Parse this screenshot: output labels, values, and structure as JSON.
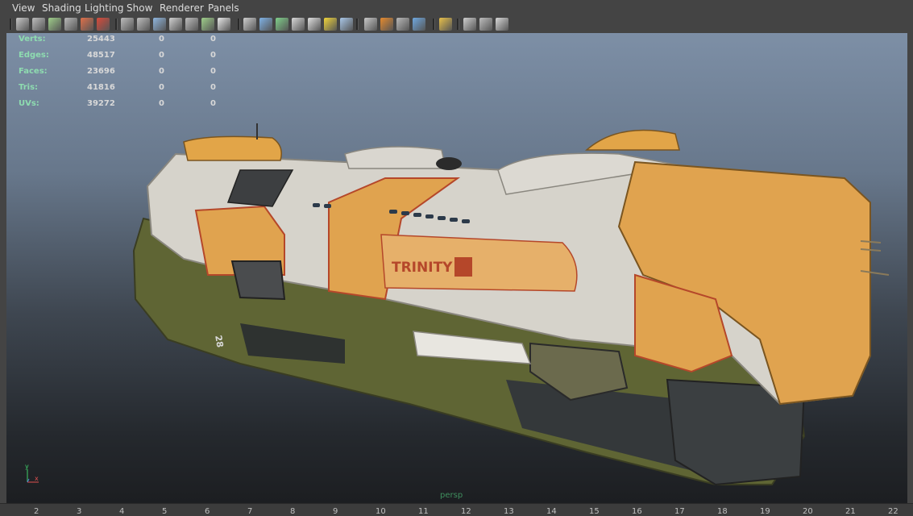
{
  "menu": [
    "View",
    "Shading",
    "Lighting",
    "Show",
    "Renderer",
    "Panels"
  ],
  "toolbar_icons": [
    {
      "name": "camera-icon",
      "color": "#c8c8c8"
    },
    {
      "name": "camera-attributes-icon",
      "color": "#bdbdbd"
    },
    {
      "name": "bookmark-icon",
      "color": "#9fcf8a"
    },
    {
      "name": "image-plane-icon",
      "color": "#b8b8b8"
    },
    {
      "name": "pan-zoom-icon",
      "color": "#e0704a"
    },
    {
      "name": "grease-pencil-icon",
      "color": "#d94a3a"
    },
    {
      "name": "grid-icon",
      "color": "#bdbdbd"
    },
    {
      "name": "film-gate-icon",
      "color": "#bdbdbd"
    },
    {
      "name": "resolution-gate-icon",
      "color": "#8fb6e0"
    },
    {
      "name": "gate-mask-icon",
      "color": "#d0d0d0"
    },
    {
      "name": "field-chart-icon",
      "color": "#bdbdbd"
    },
    {
      "name": "safe-action-icon",
      "color": "#9fcf8a"
    },
    {
      "name": "safe-title-icon",
      "color": "#e8e8e8"
    },
    {
      "name": "wireframe-icon",
      "color": "#cfcfcf"
    },
    {
      "name": "smooth-shade-icon",
      "color": "#7fb2e6"
    },
    {
      "name": "wireframe-on-shaded-icon",
      "color": "#7fd08a"
    },
    {
      "name": "default-material-icon",
      "color": "#d8d8d8"
    },
    {
      "name": "textured-icon",
      "color": "#e0e0e0"
    },
    {
      "name": "use-all-lights-icon",
      "color": "#f0d53a"
    },
    {
      "name": "shadows-icon",
      "color": "#a9c7e8"
    },
    {
      "name": "screen-space-ao-icon",
      "color": "#c8c8c8"
    },
    {
      "name": "motion-blur-icon",
      "color": "#e68a2e"
    },
    {
      "name": "anti-aliasing-icon",
      "color": "#b8b8b8"
    },
    {
      "name": "depth-of-field-icon",
      "color": "#6fa8e0"
    },
    {
      "name": "isolate-select-icon",
      "color": "#e8c04a"
    },
    {
      "name": "xray-icon",
      "color": "#cfcfcf"
    },
    {
      "name": "xray-joints-icon",
      "color": "#bdbdbd"
    },
    {
      "name": "xray-components-icon",
      "color": "#d8d8d8"
    }
  ],
  "hud": {
    "rows": [
      {
        "label": "Verts:",
        "v1": "25443",
        "v2": "0",
        "v3": "0"
      },
      {
        "label": "Edges:",
        "v1": "48517",
        "v2": "0",
        "v3": "0"
      },
      {
        "label": "Faces:",
        "v1": "23696",
        "v2": "0",
        "v3": "0"
      },
      {
        "label": "Tris:",
        "v1": "41816",
        "v2": "0",
        "v3": "0"
      },
      {
        "label": "UVs:",
        "v1": "39272",
        "v2": "0",
        "v3": "0"
      }
    ]
  },
  "ship": {
    "decal": "TRINITY",
    "hull_number": "28"
  },
  "axis": {
    "y": "y",
    "x": "x"
  },
  "camera": "persp",
  "ruler": [
    "2",
    "3",
    "4",
    "5",
    "6",
    "7",
    "8",
    "9",
    "10",
    "11",
    "12",
    "13",
    "14",
    "15",
    "16",
    "17",
    "18",
    "19",
    "20",
    "21",
    "22"
  ]
}
